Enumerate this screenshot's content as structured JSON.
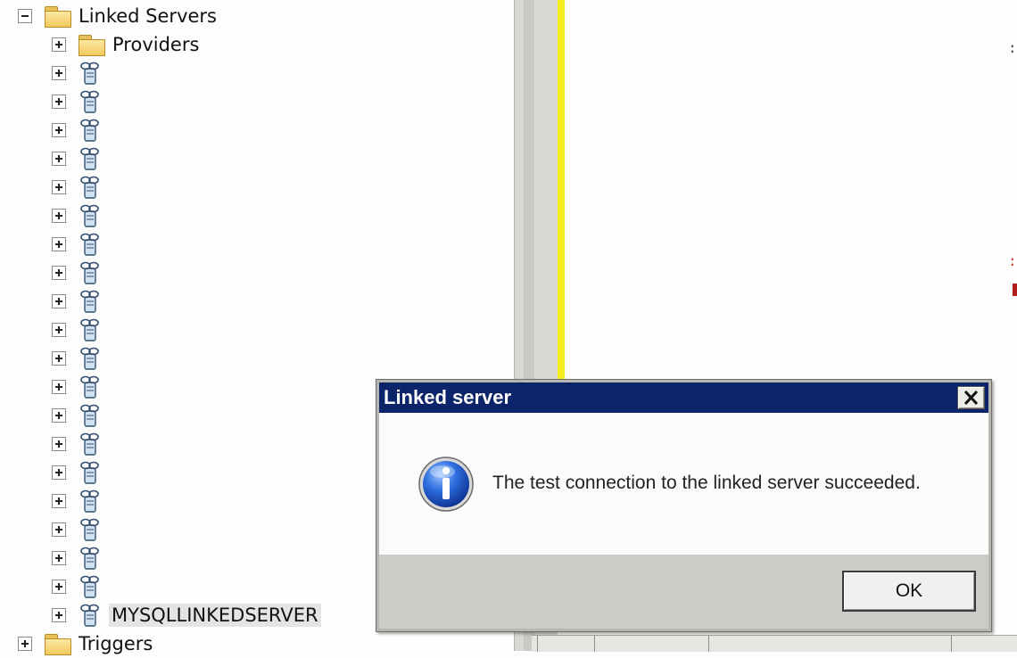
{
  "tree": {
    "root": {
      "label": "Linked Servers",
      "icon": "folder-icon"
    },
    "providers": {
      "label": "Providers",
      "icon": "folder-icon"
    },
    "server_items": [
      {
        "label": ""
      },
      {
        "label": ""
      },
      {
        "label": ""
      },
      {
        "label": ""
      },
      {
        "label": ""
      },
      {
        "label": ""
      },
      {
        "label": ""
      },
      {
        "label": ""
      },
      {
        "label": ""
      },
      {
        "label": ""
      },
      {
        "label": ""
      },
      {
        "label": ""
      },
      {
        "label": ""
      },
      {
        "label": ""
      },
      {
        "label": ""
      },
      {
        "label": ""
      },
      {
        "label": ""
      },
      {
        "label": ""
      },
      {
        "label": ""
      }
    ],
    "selected_item": {
      "label": "MYSQLLINKEDSERVER",
      "icon": "linked-server-icon"
    },
    "triggers": {
      "label": "Triggers",
      "icon": "folder-icon"
    }
  },
  "dialog": {
    "title": "Linked server",
    "close_icon": "close-icon",
    "message_icon": "info-icon",
    "message": "The test connection to the linked server succeeded.",
    "ok_label": "OK"
  },
  "colors": {
    "titlebar": "#0c246a",
    "editor_margin": "#f4ee21",
    "dialog_footer": "#cbcbc8",
    "selection": "#e4e4e4"
  }
}
